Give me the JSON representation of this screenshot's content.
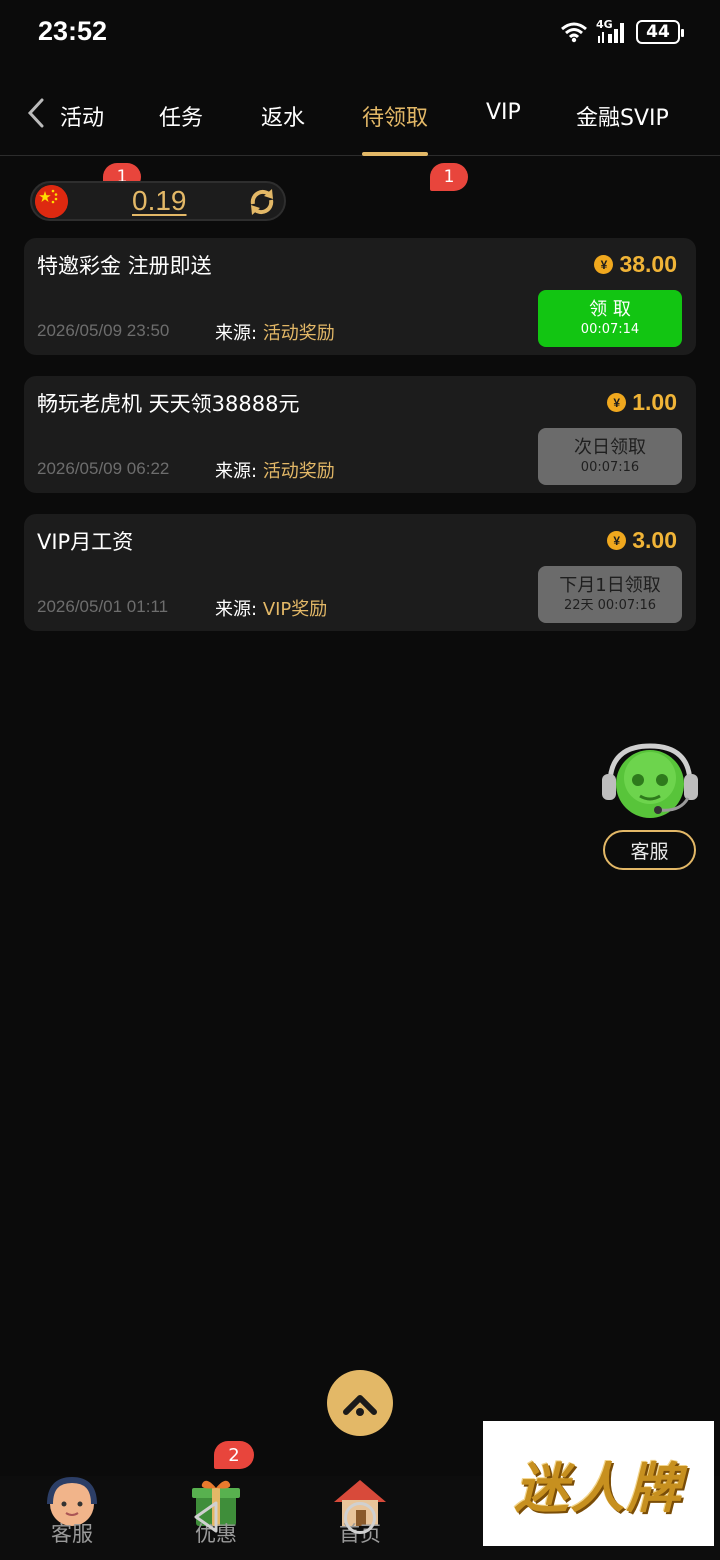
{
  "status_bar": {
    "time": "23:52",
    "network": "4G",
    "battery": "44"
  },
  "tabs": [
    {
      "label": "活动",
      "badge": "1"
    },
    {
      "label": "任务"
    },
    {
      "label": "返水"
    },
    {
      "label": "待领取",
      "badge": "1",
      "active": true
    },
    {
      "label": "VIP"
    },
    {
      "label": "金融SVIP"
    }
  ],
  "balance": {
    "value": "0.19"
  },
  "source_label": "来源:",
  "rewards": [
    {
      "title": "特邀彩金 注册即送",
      "amount": "38.00",
      "date": "2026/05/09 23:50",
      "source": "活动奖励",
      "button_label": "领 取",
      "button_timer": "00:07:14",
      "button_state": "claimable"
    },
    {
      "title": "畅玩老虎机 天天领38888元",
      "amount": "1.00",
      "date": "2026/05/09 06:22",
      "source": "活动奖励",
      "button_label": "次日领取",
      "button_timer": "00:07:16",
      "button_state": "disabled"
    },
    {
      "title": "VIP月工资",
      "amount": "3.00",
      "date": "2026/05/01 01:11",
      "source": "VIP奖励",
      "button_label": "下月1日领取",
      "button_timer": "22天 00:07:16",
      "button_state": "disabled"
    }
  ],
  "customer_service": {
    "label": "客服"
  },
  "bottom_nav": [
    {
      "label": "客服",
      "icon": "support-agent-icon"
    },
    {
      "label": "优惠",
      "icon": "gift-icon",
      "badge": "2"
    },
    {
      "label": "首页",
      "icon": "home-icon"
    }
  ],
  "watermark": {
    "text": "迷人牌"
  },
  "colors": {
    "accent": "#e3b867",
    "badge": "#e8453c",
    "claim_green": "#12c512",
    "amount": "#f0b437",
    "card_bg": "#1c1c1c"
  }
}
